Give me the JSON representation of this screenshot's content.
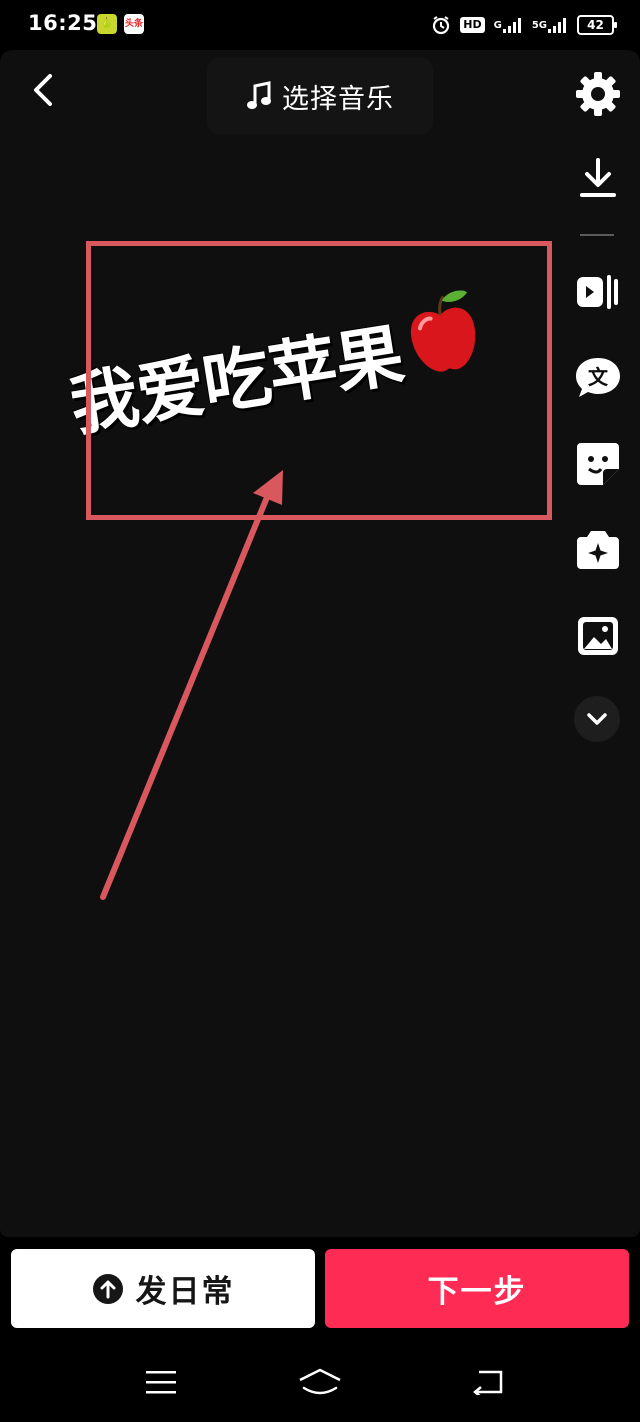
{
  "status_bar": {
    "time": "16:25",
    "app_icon_1": "🍐",
    "app_icon_2": "头条",
    "hd_label": "HD",
    "net_1_label": "G",
    "net_2_label": "5G",
    "battery_level": "42"
  },
  "top_bar": {
    "music_label": "选择音乐",
    "icons": [
      "back-icon",
      "music-note-icon",
      "settings-icon"
    ]
  },
  "side_tools": [
    "download-icon",
    "split-icon",
    "text-icon",
    "sticker-icon",
    "effect-icon",
    "image-icon",
    "chevron-down-icon"
  ],
  "canvas": {
    "sticker_text": "我爱吃苹果",
    "sticker_emoji": "apple-icon",
    "annotation_color": "#d9585e"
  },
  "bottom": {
    "daily_label": "发日常",
    "next_label": "下一步",
    "accent_color": "#fe2c55"
  },
  "nav": {
    "icons": [
      "menu-icon",
      "home-icon",
      "back-nav-icon"
    ]
  }
}
